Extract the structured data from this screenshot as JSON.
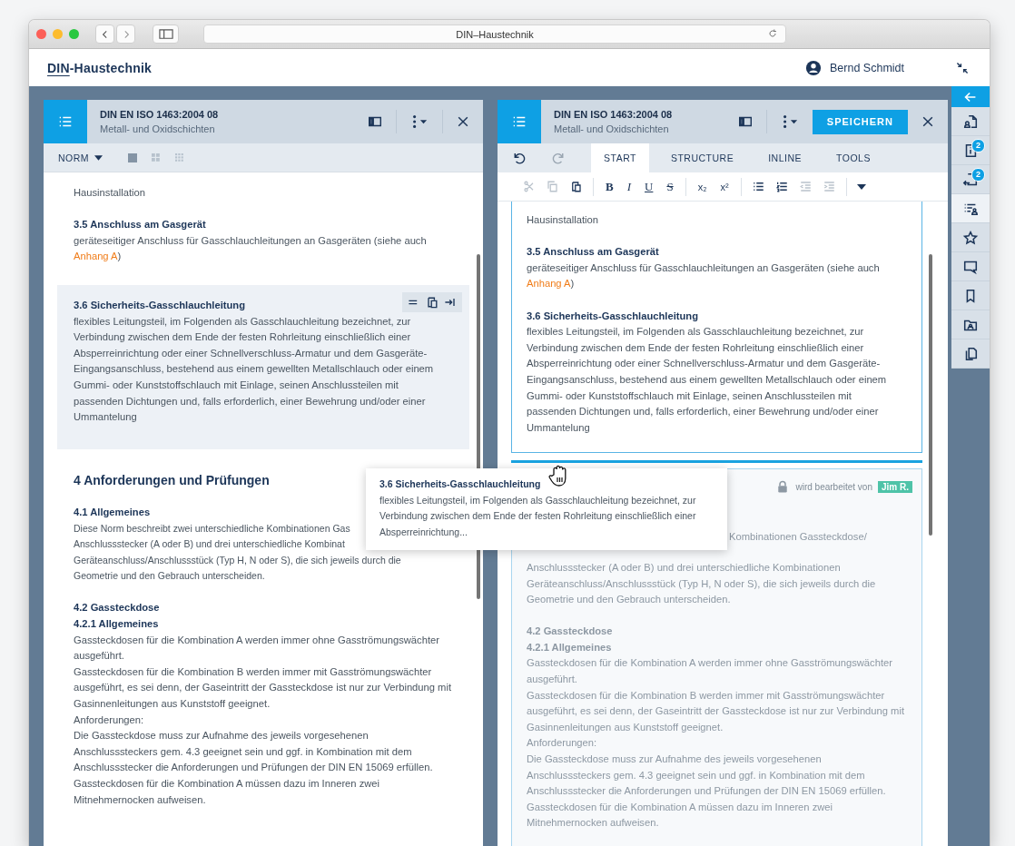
{
  "browser": {
    "url": "DIN–Haustechnik"
  },
  "app": {
    "logo_prefix": "DIN",
    "logo_suffix": "-Haustechnik",
    "user": "Bernd Schmidt"
  },
  "left_panel": {
    "title": "DIN EN ISO 1463:2004 08",
    "subtitle": "Metall- und Oxidschichten",
    "view": "NORM",
    "layouts": [
      {
        "kind": "single",
        "selected": true
      },
      {
        "kind": "grid4",
        "selected": false
      },
      {
        "kind": "grid9",
        "selected": false
      }
    ],
    "blocks": [
      {
        "kind": "label",
        "text": "Hausinstallation"
      },
      {
        "kind": "heading",
        "text": "3.5 Anschluss am Gasgerät"
      },
      {
        "kind": "text",
        "text": "geräteseitiger Anschluss für Gasschlauchleitungen an Gasgeräten (siehe auch",
        "link": "Anhang A",
        "after": ")"
      },
      {
        "kind": "section",
        "selected": true,
        "heading": "3.6 Sicherheits-Gasschlauchleitung",
        "text": "flexibles Leitungsteil, im Folgenden als Gasschlauchleitung bezeichnet, zur Verbindung zwischen dem Ende der festen Rohrleitung einschließlich einer Absperreinrichtung oder einer Schnellverschluss-Armatur und dem Gasgeräte-Eingangsanschluss, bestehend aus einem gewellten Metallschlauch oder einem Gummi- oder Kunststoffschlauch mit Einlage, seinen Anschlussteilen mit passenden Dichtungen und, falls erforderlich, einer Bewehrung und/oder einer Ummantelung"
      },
      {
        "kind": "chapter",
        "text": "4 Anforderungen und Prüfungen"
      },
      {
        "kind": "heading",
        "text": "4.1 Allgemeines"
      },
      {
        "kind": "lines",
        "lines": [
          "Diese Norm beschreibt zwei unterschiedliche Kombinationen Gas",
          "Anschlussstecker (A oder B) und drei unterschiedliche Kombinat",
          "Geräteanschluss/Anschlussstück (Typ H, N oder S), die sich jeweils durch die",
          "Geometrie und den Gebrauch unterscheiden."
        ]
      },
      {
        "kind": "heading",
        "text": "4.2 Gassteckdose"
      },
      {
        "kind": "heading",
        "text": "4.2.1 Allgemeines"
      },
      {
        "kind": "text",
        "text": "Gassteckdosen für die Kombination A werden immer ohne Gasströmungswächter ausgeführt."
      },
      {
        "kind": "text",
        "text": "Gassteckdosen für die Kombination B werden immer mit Gasströmungswächter ausgeführt, es sei denn, der Gaseintritt der Gassteckdose ist nur zur Verbindung mit Gasinnenleitungen aus Kunststoff geeignet."
      },
      {
        "kind": "text",
        "text": "Anforderungen:"
      },
      {
        "kind": "text",
        "text": "Die Gassteckdose muss zur Aufnahme des jeweils vorgesehenen Anschlusssteckers gem. 4.3 geeignet sein und ggf. in Kombination mit dem Anschlussstecker die Anforderungen und Prüfungen der DIN EN 15069 erfüllen."
      },
      {
        "kind": "text",
        "text": "Gassteckdosen für die Kombination A müssen dazu im Inneren zwei Mitnehmernocken aufweisen."
      }
    ]
  },
  "right_panel": {
    "title": "DIN EN ISO 1463:2004 08",
    "subtitle": "Metall- und Oxidschichten",
    "save_button": "SPEICHERN",
    "undo": {
      "disabled": false
    },
    "redo": {
      "disabled": true
    },
    "tabs": [
      {
        "label": "START",
        "selected": true
      },
      {
        "label": "STRUCTURE",
        "selected": false
      },
      {
        "label": "INLINE",
        "selected": false
      },
      {
        "label": "TOOLS",
        "selected": false
      }
    ],
    "format_groups": [
      [
        {
          "kind": "cut",
          "disabled": true
        },
        {
          "kind": "copy",
          "disabled": true
        },
        {
          "kind": "paste",
          "disabled": false
        }
      ],
      [
        {
          "kind": "bold",
          "label": "B",
          "disabled": false
        },
        {
          "kind": "italic",
          "label": "I",
          "disabled": false
        },
        {
          "kind": "underline",
          "label": "U",
          "disabled": false
        },
        {
          "kind": "strike",
          "label": "S",
          "disabled": false
        }
      ],
      [
        {
          "kind": "sub",
          "label": "x₂",
          "disabled": false
        },
        {
          "kind": "sup",
          "label": "x²",
          "disabled": false
        }
      ],
      [
        {
          "kind": "bullets",
          "disabled": false
        },
        {
          "kind": "numbers",
          "disabled": false
        },
        {
          "kind": "outdent",
          "disabled": true
        },
        {
          "kind": "indent",
          "disabled": true
        }
      ],
      [
        {
          "kind": "more",
          "disabled": false
        }
      ]
    ],
    "edit_blocks": [
      {
        "kind": "label",
        "text": "Hausinstallation"
      },
      {
        "kind": "heading",
        "text": "3.5 Anschluss am Gasgerät"
      },
      {
        "kind": "text",
        "text": "geräteseitiger Anschluss für Gasschlauchleitungen an Gasgeräten (siehe auch",
        "link": "Anhang A",
        "after": ")"
      },
      {
        "kind": "section",
        "selected": false,
        "heading": "3.6 Sicherheits-Gasschlauchleitung",
        "text": "flexibles Leitungsteil, im Folgenden als Gasschlauchleitung bezeichnet, zur Verbindung zwischen dem Ende der festen Rohrleitung einschließlich einer Absperreinrichtung oder einer Schnellverschluss-Armatur und dem Gasgeräte-Eingangsanschluss, bestehend aus einem gewellten Metallschlauch oder einem Gummi- oder Kunststoffschlauch mit Einlage, seinen Anschlussteilen mit passenden Dichtungen und, falls erforderlich, einer Bewehrung und/oder einer Ummantelung"
      }
    ],
    "locked": {
      "status": "wird bearbeitet von",
      "user": "Jim R.",
      "blocks": [
        {
          "kind": "fragment",
          "text": "Kombinationen Gassteckdose/"
        },
        {
          "kind": "text",
          "text": "Anschlussstecker (A oder B) und drei unterschiedliche Kombinationen Geräteanschluss/Anschlussstück (Typ H, N oder S), die sich jeweils durch die Geometrie und den Gebrauch unterscheiden."
        },
        {
          "kind": "heading",
          "text": "4.2 Gassteckdose"
        },
        {
          "kind": "heading",
          "text": "4.2.1 Allgemeines"
        },
        {
          "kind": "text",
          "text": "Gassteckdosen für die Kombination A werden immer ohne Gasströmungswächter ausgeführt."
        },
        {
          "kind": "text",
          "text": "Gassteckdosen für die Kombination B werden immer mit Gasströmungswächter ausgeführt, es sei denn, der Gaseintritt der Gassteckdose ist nur zur Verbindung mit Gasinnenleitungen aus Kunststoff geeignet."
        },
        {
          "kind": "text",
          "text": "Anforderungen:"
        },
        {
          "kind": "text",
          "text": "Die Gassteckdose muss zur Aufnahme des jeweils vorgesehenen Anschlusssteckers gem. 4.3 geeignet sein und ggf. in Kombination mit dem Anschlussstecker die Anforderungen und Prüfungen der DIN EN 15069 erfüllen."
        },
        {
          "kind": "text",
          "text": "Gassteckdosen für die Kombination A müssen dazu im Inneren zwei Mitnehmernocken aufweisen."
        }
      ]
    }
  },
  "tooltip": {
    "heading": "3.6 Sicherheits-Gasschlauchleitung",
    "text": "flexibles Leitungsteil, im Folgenden als Gasschlauchleitung bezeichnet, zur Verbindung zwischen dem Ende der festen Rohrleitung einschließlich einer Absperreinrichtung..."
  },
  "rail": {
    "items": [
      {
        "kind": "doc-person",
        "selected": false
      },
      {
        "kind": "doc-info",
        "badge": "2",
        "selected": false
      },
      {
        "kind": "doc-swap",
        "badge": "2",
        "selected": false
      },
      {
        "kind": "list-person",
        "selected": true
      },
      {
        "kind": "star",
        "selected": false
      },
      {
        "kind": "comment",
        "selected": false
      },
      {
        "kind": "bookmark",
        "selected": false
      },
      {
        "kind": "folder-person",
        "selected": false
      },
      {
        "kind": "copy-doc",
        "selected": false
      }
    ]
  }
}
